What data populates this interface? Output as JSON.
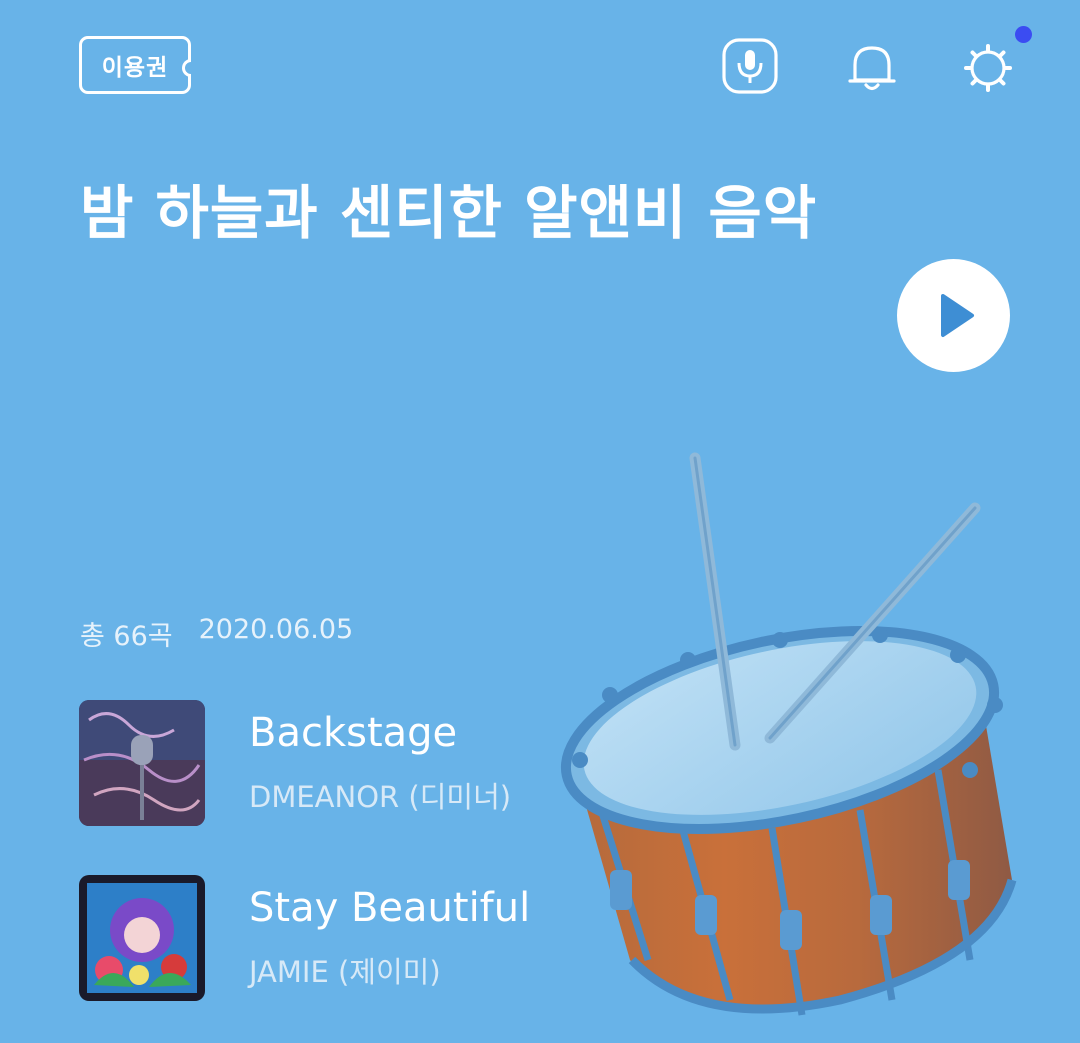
{
  "header": {
    "ticket_label": "이용권",
    "icons": [
      "mic-icon",
      "bell-icon",
      "gear-icon"
    ],
    "notification_dot_color": "#3b4cf2"
  },
  "playlist": {
    "title": "밤 하늘과 센티한 알앤비 음악",
    "total": "총 66곡",
    "date": "2020.06.05",
    "background_color": "#68b3e8",
    "cover_art": "drum-with-drumsticks-illustration"
  },
  "tracks": [
    {
      "title": "Backstage",
      "artist": "DMEANOR (디미너)"
    },
    {
      "title": "Stay Beautiful",
      "artist": "JAMIE (제이미)"
    }
  ]
}
